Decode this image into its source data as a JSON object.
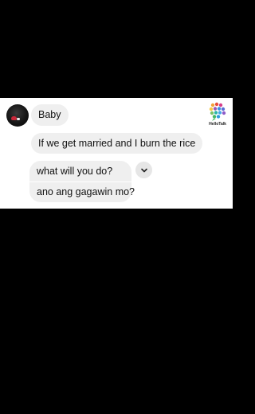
{
  "app": {
    "watermark_text": "HelloTalk"
  },
  "contact": {
    "avatar_icon": "profile-photo"
  },
  "messages": [
    {
      "text": "Baby"
    },
    {
      "text": "If we get married and I burn the rice"
    },
    {
      "text": "what will you do?",
      "translation": "ano ang gagawin mo?"
    }
  ],
  "colors": {
    "background": "#000000",
    "chat_background": "#ffffff",
    "bubble": "#efefef",
    "text": "#111111"
  },
  "icons": {
    "more": "chevron-down-icon",
    "logo": "hellotalk-logo-icon"
  }
}
